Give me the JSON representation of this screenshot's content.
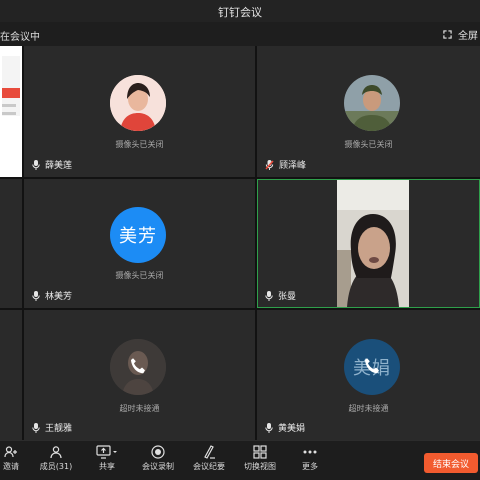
{
  "window": {
    "title": "钉钉会议"
  },
  "header": {
    "meeting_status": "在会议中",
    "fullscreen_label": "全屏"
  },
  "participants": [
    {
      "name": "薛美莲",
      "status": "摄像头已关闭",
      "mic_icon": "microphone-icon"
    },
    {
      "name": "顾泽峰",
      "status": "摄像头已关闭",
      "mic_icon": "muted-microphone-icon"
    },
    {
      "name": "林美芳",
      "status": "摄像头已关闭",
      "avatar_text": "美芳",
      "mic_icon": "microphone-icon"
    },
    {
      "name": "张曼",
      "status": "",
      "mic_icon": "microphone-icon"
    },
    {
      "name": "王靓雅",
      "status": "超时未接通",
      "mic_icon": "microphone-icon"
    },
    {
      "name": "黄美娟",
      "status": "超时未接通",
      "avatar_text": "美娟",
      "mic_icon": "microphone-icon"
    }
  ],
  "toolbar": {
    "invite": "邀请",
    "members": "成员(31)",
    "share": "共享",
    "record": "会议录制",
    "minutes": "会议纪要",
    "view": "切换视图",
    "more": "更多",
    "end": "结束会议"
  },
  "colors": {
    "accent": "#1c8cf5",
    "speaking_border": "#2fa04b",
    "end_button": "#f25b2f"
  }
}
